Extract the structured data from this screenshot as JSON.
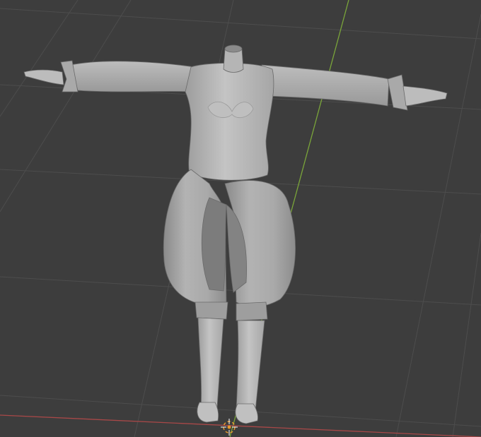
{
  "viewport": {
    "background": "#3d3d3d",
    "grid_color": "#4a4a4a",
    "y_axis_color": "#7aa53a",
    "x_axis_color": "#a84848",
    "mesh_color": "#b8b8b8",
    "mesh_shade": "#8f8f8f",
    "cursor_color": "#e89a2c"
  },
  "icons": {
    "origin": "3d-cursor-icon"
  }
}
